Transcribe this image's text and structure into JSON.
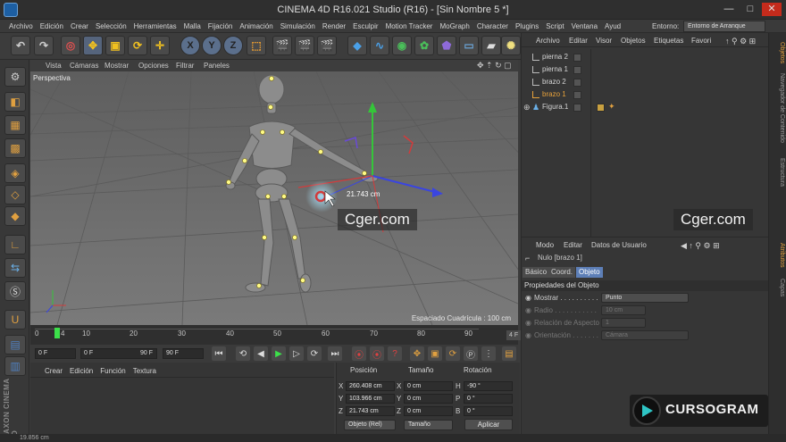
{
  "window": {
    "title": "CINEMA 4D R16.021 Studio (R16) - [Sin Nombre 5 *]",
    "controls": [
      "—",
      "□",
      "✕"
    ]
  },
  "menubar": {
    "items": [
      "Archivo",
      "Edición",
      "Crear",
      "Selección",
      "Herramientas",
      "Malla",
      "Fijación",
      "Animación",
      "Simulación",
      "Render",
      "Esculpir",
      "Motion Tracker",
      "MoGraph",
      "Character",
      "Plugins",
      "Script",
      "Ventana",
      "Ayud"
    ],
    "env_label": "Entorno:",
    "env_value": "Entorno de Arranque"
  },
  "toolbar": {
    "axis_x": "X",
    "axis_y": "Y",
    "axis_z": "Z"
  },
  "viewport": {
    "menu": [
      "Vista",
      "Cámaras",
      "Mostrar",
      "Opciones",
      "Filtrar",
      "Paneles"
    ],
    "label": "Perspectiva",
    "grid_spacing": "Espaciado Cuadrícula : 100 cm",
    "measure": "21.743 cm",
    "watermark": "Cger.com"
  },
  "timeline": {
    "ticks": [
      "0",
      "4",
      "10",
      "20",
      "30",
      "40",
      "50",
      "60",
      "70",
      "80",
      "90"
    ],
    "current_frame": "4 F",
    "start_field": "0 F",
    "range_start": "0 F",
    "range_end": "90 F",
    "end_field": "90 F"
  },
  "material_manager": {
    "menu": [
      "Crear",
      "Edición",
      "Función",
      "Textura"
    ]
  },
  "coordinates": {
    "headers": {
      "position": "Posición",
      "size": "Tamaño",
      "rotation": "Rotación"
    },
    "rows": [
      {
        "axis": "X",
        "pos": "260.408 cm",
        "size_axis": "X",
        "size": "0 cm",
        "rot_axis": "H",
        "rot": "-90 °"
      },
      {
        "axis": "Y",
        "pos": "103.966 cm",
        "size_axis": "Y",
        "size": "0 cm",
        "rot_axis": "P",
        "rot": "0 °"
      },
      {
        "axis": "Z",
        "pos": "21.743 cm",
        "size_axis": "Z",
        "size": "0 cm",
        "rot_axis": "B",
        "rot": "0 °"
      }
    ],
    "mode_select": "Objeto (Rel)",
    "size_select": "Tamaño",
    "apply_label": "Aplicar"
  },
  "object_manager": {
    "menu": [
      "Archivo",
      "Editar",
      "Visor",
      "Objetos",
      "Etiquetas",
      "Favori"
    ],
    "objects": [
      {
        "name": "pierna 2",
        "selected": false
      },
      {
        "name": "pierna 1",
        "selected": false
      },
      {
        "name": "brazo 2",
        "selected": false
      },
      {
        "name": "brazo 1",
        "selected": true
      },
      {
        "name": "Figura.1",
        "selected": false
      }
    ],
    "watermark": "Cger.com"
  },
  "attribute_manager": {
    "menu": [
      "Modo",
      "Editar",
      "Datos de Usuario"
    ],
    "object_title": "Nulo [brazo 1]",
    "tabs": [
      "Básico",
      "Coord.",
      "Objeto"
    ],
    "active_tab": "Objeto",
    "section_title": "Propiedades del Objeto",
    "fields": [
      {
        "label": "Mostrar . . . . . . . . . .",
        "value": "Punto",
        "enabled": true
      },
      {
        "label": "Radio . . . . . . . . . . .",
        "value": "10 cm",
        "enabled": false
      },
      {
        "label": "Relación de Aspecto",
        "value": "1",
        "enabled": false
      },
      {
        "label": "Orientación . . . . . . .",
        "value": "Cámara",
        "enabled": false
      }
    ]
  },
  "right_strip": [
    "Objetos",
    "Navegador de Contenido",
    "Estructura",
    "Atributos",
    "Capas"
  ],
  "branding": {
    "maxon": "MAXON CINEMA 4D",
    "cursogram": "CURSOGRAM"
  },
  "status_text": "19.856 cm",
  "colors": {
    "accent_selected": "#e8a23b",
    "tab_active": "#5d7fb7",
    "axis_green": "#35c53a",
    "axis_red": "#d33b3b",
    "axis_blue": "#3a45e0"
  }
}
